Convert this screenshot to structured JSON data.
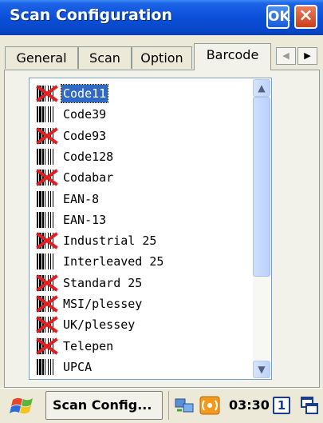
{
  "window": {
    "title": "Scan Configuration",
    "ok_label": "OK",
    "close_label": "×"
  },
  "tabs": [
    {
      "label": "General"
    },
    {
      "label": "Scan"
    },
    {
      "label": "Option"
    },
    {
      "label": "Barcode"
    }
  ],
  "active_tab": "Barcode",
  "barcode_list": {
    "items": [
      {
        "label": "Code11",
        "enabled": false,
        "selected": true
      },
      {
        "label": "Code39",
        "enabled": true
      },
      {
        "label": "Code93",
        "enabled": false
      },
      {
        "label": "Code128",
        "enabled": true
      },
      {
        "label": "Codabar",
        "enabled": false
      },
      {
        "label": "EAN-8",
        "enabled": true
      },
      {
        "label": "EAN-13",
        "enabled": true
      },
      {
        "label": "Industrial 25",
        "enabled": false
      },
      {
        "label": "Interleaved 25",
        "enabled": true
      },
      {
        "label": "Standard 25",
        "enabled": false
      },
      {
        "label": "MSI/plessey",
        "enabled": false
      },
      {
        "label": "UK/plessey",
        "enabled": false
      },
      {
        "label": "Telepen",
        "enabled": false
      },
      {
        "label": "UPCA",
        "enabled": true
      }
    ],
    "scroll_fraction": 0.0
  },
  "taskbar": {
    "task_label": "Scan Config...",
    "clock": "03:30",
    "desktop_number": "1"
  },
  "colors": {
    "titlebar": "#0a4fd8",
    "selection": "#316ac5",
    "disabled_mark": "#e02020"
  }
}
